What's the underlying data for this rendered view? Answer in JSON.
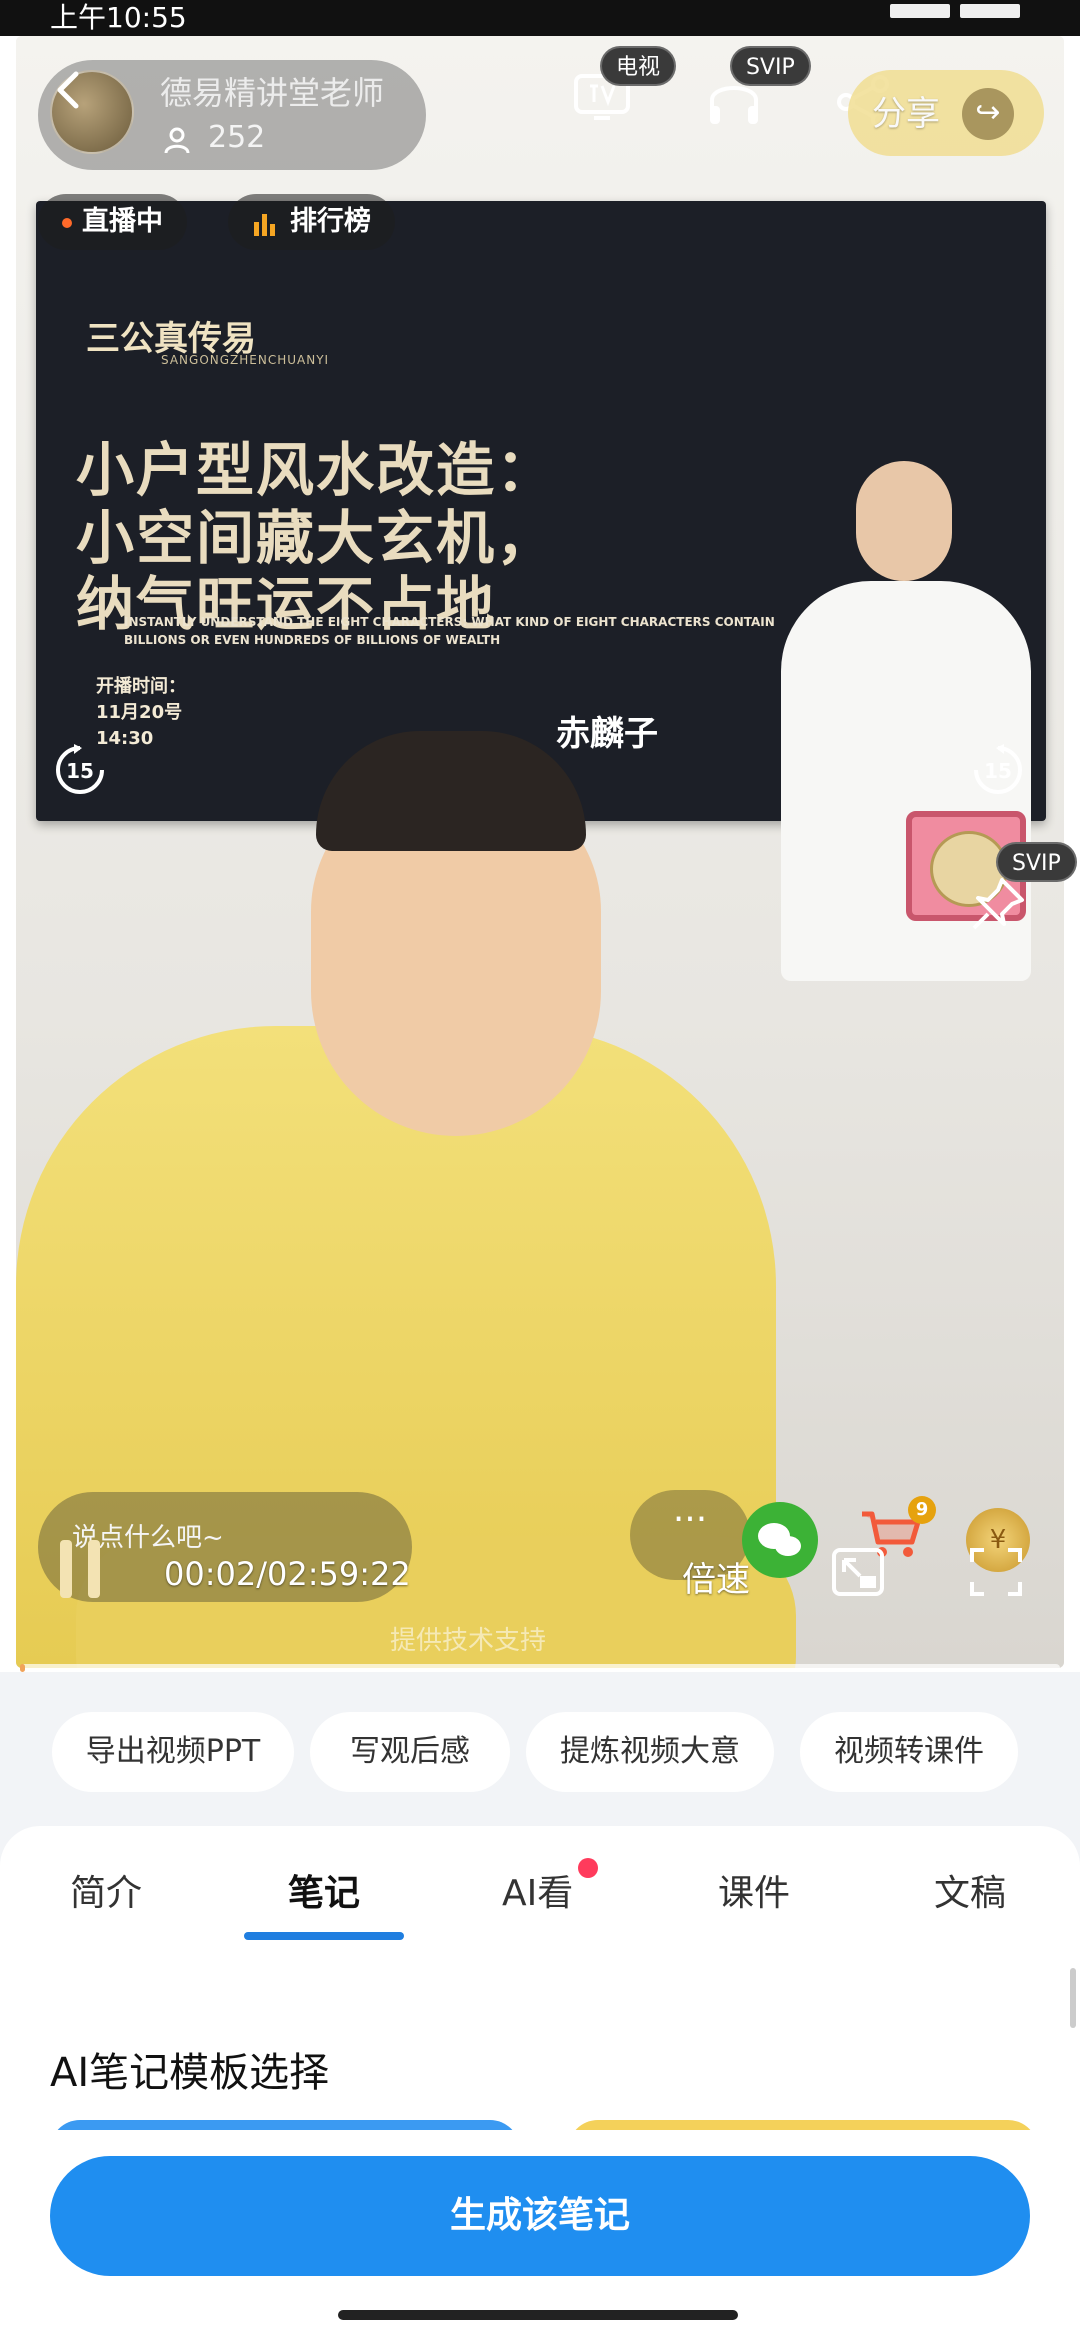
{
  "status_bar": {
    "time": "上午10:55"
  },
  "live": {
    "channel_name": "德易精讲堂老师",
    "viewer_count": "252",
    "live_label": "直播中",
    "rank_label": "排行榜",
    "tv_badge": "电视",
    "audio_badge": "SVIP",
    "pin_badge": "SVIP",
    "share_label": "分享"
  },
  "screen_slide": {
    "brand": "三公真传易",
    "brand_sub": "SANGONGZHENCHUANYI",
    "title_lines": [
      "小户型风水改造：",
      "小空间藏大玄机，",
      "纳气旺运不占地"
    ],
    "subtitle_en": "INSTANTLY UNDERSTAND THE EIGHT CHARACTERS: WHAT KIND OF EIGHT CHARACTERS CONTAIN BILLIONS OR EVEN HUNDREDS OF BILLIONS OF WEALTH",
    "start_time_label": "开播时间：",
    "start_date": "11月20号",
    "start_clock": "14:30",
    "host": "赤麟子"
  },
  "player": {
    "comment_placeholder": "说点什么吧~",
    "time_display": "00:02/02:59:22",
    "speed_label": "倍速",
    "more_label": "···",
    "cart_count": "9",
    "rewind_label": "15",
    "forward_label": "15",
    "watermark": "提供技术支持",
    "progress": 0.001
  },
  "chips": [
    "导出视频PPT",
    "写观后感",
    "提炼视频大意",
    "视频转课件"
  ],
  "tabs": [
    "简介",
    "笔记",
    "AI看",
    "课件",
    "文稿"
  ],
  "active_tab": "笔记",
  "section_title": "AI笔记模板选择",
  "cta_label": "生成该笔记",
  "colors": {
    "accent": "#1f8ef0",
    "tab_underline": "#1f7ee0",
    "notice_dot": "#ff3b5c",
    "live_dot": "#ff6a2a"
  }
}
